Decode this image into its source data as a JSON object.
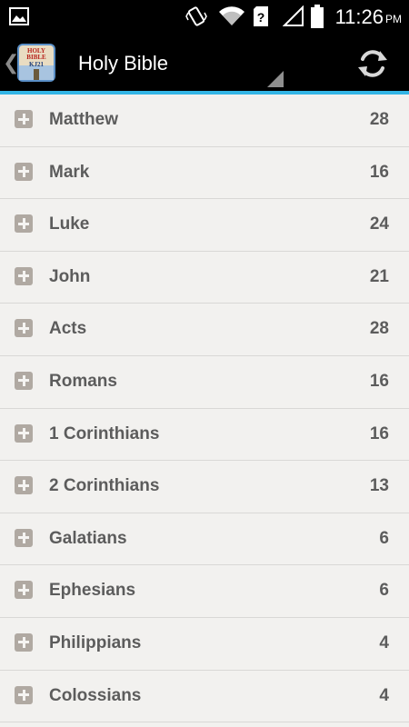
{
  "status_bar": {
    "time": "11:26",
    "ampm": "PM",
    "icons": [
      "gallery-icon",
      "vibrate-icon",
      "wifi-icon",
      "sim-unknown-icon",
      "signal-icon",
      "battery-icon"
    ]
  },
  "action_bar": {
    "title": "Holy Bible",
    "app_icon_text": [
      "HOLY",
      "BIBLE",
      "KJ21"
    ],
    "accent_color": "#33b5e5"
  },
  "books": [
    {
      "name": "Matthew",
      "chapters": "28"
    },
    {
      "name": "Mark",
      "chapters": "16"
    },
    {
      "name": "Luke",
      "chapters": "24"
    },
    {
      "name": "John",
      "chapters": "21"
    },
    {
      "name": "Acts",
      "chapters": "28"
    },
    {
      "name": "Romans",
      "chapters": "16"
    },
    {
      "name": "1 Corinthians",
      "chapters": "16"
    },
    {
      "name": "2 Corinthians",
      "chapters": "13"
    },
    {
      "name": "Galatians",
      "chapters": "6"
    },
    {
      "name": "Ephesians",
      "chapters": "6"
    },
    {
      "name": "Philippians",
      "chapters": "4"
    },
    {
      "name": "Colossians",
      "chapters": "4"
    }
  ]
}
